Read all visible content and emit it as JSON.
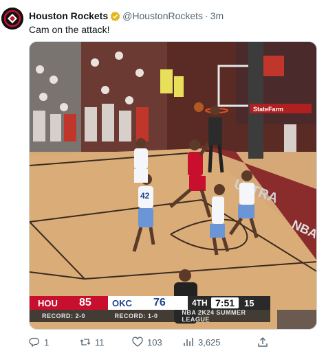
{
  "tweet": {
    "display_name": "Houston Rockets",
    "handle": "@HoustonRockets",
    "separator": "·",
    "time": "3m",
    "text": "Cam on the attack!",
    "icons": {
      "avatar": "rockets-logo",
      "verified": "verified-badge-icon"
    }
  },
  "media": {
    "arena_text": {
      "sponsor": "StateFarm",
      "court": "ULTRA",
      "baseline": "NBA"
    },
    "players": [
      {
        "jersey": "42"
      }
    ],
    "scorebug": {
      "home_abbr": "HOU",
      "home_score": "85",
      "away_abbr": "OKC",
      "away_score": "76",
      "period": "4TH",
      "clock": "7:51",
      "shot_clock": "15",
      "home_record": "RECORD: 2-0",
      "away_record": "RECORD: 1-0",
      "league": "NBA 2K24 SUMMER LEAGUE",
      "colors": {
        "hou": "#c8102e",
        "okc": "#1d428a"
      }
    }
  },
  "actions": {
    "reply": {
      "icon": "reply-icon",
      "count": "1"
    },
    "retweet": {
      "icon": "retweet-icon",
      "count": "11"
    },
    "like": {
      "icon": "heart-icon",
      "count": "103"
    },
    "views": {
      "icon": "views-icon",
      "count": "3,625"
    },
    "share": {
      "icon": "share-icon"
    }
  }
}
